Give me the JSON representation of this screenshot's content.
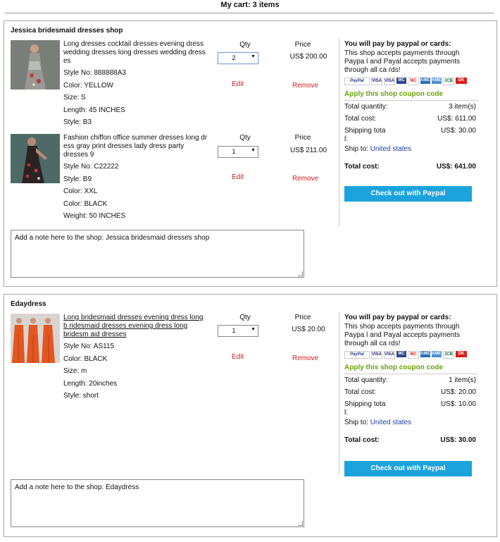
{
  "cart_title": "My cart: 3 items",
  "colors": {
    "checkout": "#1ba3dd",
    "remove": "#d02020",
    "coupon": "#6aa10d",
    "link": "#1a3ea8"
  },
  "labels": {
    "qty": "Qty",
    "price": "Price",
    "edit": "Edit",
    "remove": "Remove",
    "pay_head": "You will pay by paypal or cards:",
    "coupon": "Apply this shop coupon code",
    "total_quantity": "Total quantity:",
    "total_cost": "Total cost:",
    "shipping_line1": "Shipping tota",
    "shipping_line2": "l:",
    "ship_to": "Ship to:",
    "grand_total": "Total cost:",
    "checkout": "Check out with Paypal"
  },
  "logos": [
    "PayPal",
    "VISA",
    "VISA",
    "MC",
    "MC",
    "AMEX",
    "AMEX",
    "JCB",
    "DK"
  ],
  "shops": [
    {
      "name": "Jessica bridesmaid dresses shop",
      "items": [
        {
          "desc": "Long dresses cocktail dresses evening dress wedding dresses long dresses wedding dress es",
          "attrs": [
            "Style No: 888888A3",
            "Color: YELLOW",
            "Size: S",
            "Length: 45 INCHES",
            "Style: B3"
          ],
          "qty": "2",
          "price": "US$ 200.00",
          "thumb": "grey-floral-dress"
        },
        {
          "desc": "Fashion chiffon office summer dresses long dr ess gray print dresses lady dress party dresses 9",
          "attrs": [
            "Style No: C22222",
            "Style: B9",
            "Color: XXL",
            "Color: BLACK",
            "Weight: 50 INCHES"
          ],
          "qty": "1",
          "price": "US$ 211.00",
          "thumb": "black-print-dress"
        }
      ],
      "pay_note": "This shop accepts payments through Paypa l and Payal accepts payments through all ca rds!",
      "total_quantity": "3 item(s)",
      "total_cost": "US$: 611.00",
      "shipping": "US$: 30.00",
      "ship_to": "United states",
      "grand_total": "US$: 641.00",
      "note_placeholder": "Add a note here to the shop: Jessica bridesmaid dresses shop"
    },
    {
      "name": "Edaydress",
      "items": [
        {
          "desc": "Long bridesmaid dresses evening dress long b ridesmaid dresses evening dress long bridesm aid dresses",
          "attrs": [
            "Style No: AS115",
            "Color: BLACK",
            "Size: m",
            "Length: 20inches",
            "Style: short"
          ],
          "qty": "1",
          "price": "US$ 20.00",
          "thumb": "orange-bridesmaid-dresses"
        }
      ],
      "pay_note": "This shop accepts payments through Paypa l and Payal accepts payments through all ca rds!",
      "total_quantity": "1 item(s)",
      "total_cost": "US$: 20.00",
      "shipping": "US$: 10.00",
      "ship_to": "United states",
      "grand_total": "US$: 30.00",
      "note_placeholder": "Add a note here to the shop: Edaydress"
    }
  ]
}
